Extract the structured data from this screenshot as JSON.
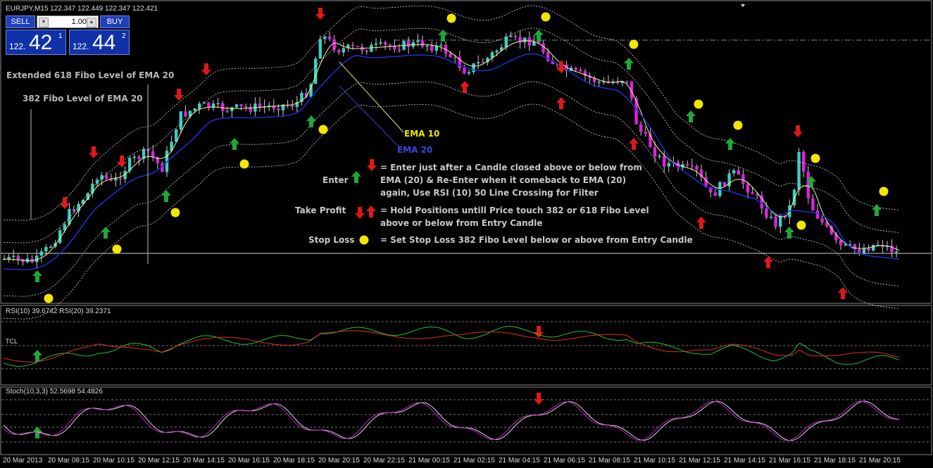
{
  "window": {
    "symbol_header": "EURJPY,M15  122.347 122.449 122.347 122.421"
  },
  "trade_panel": {
    "sell_label": "SELL",
    "buy_label": "BUY",
    "lot_value": "1.00",
    "bid_prefix": "122.",
    "bid_big": "42",
    "bid_sup": "1",
    "ask_prefix": "122.",
    "ask_big": "44",
    "ask_sup": "2"
  },
  "annotations": {
    "fibo618": "Extended 618 Fibo Level of EMA 20",
    "fibo382": "382 Fibo Level of EMA 20",
    "ema10": "EMA 10",
    "ema20": "EMA 20"
  },
  "legend": {
    "enter_label": "Enter",
    "enter_text": [
      "= Enter just after a Candle closed above or below from",
      "EMA (20) & Re-Enter when it comeback to EMA (20)",
      "again, Use RSI (10) 50 Line Crossing for Filter"
    ],
    "tp_label": "Take Profit",
    "tp_text": [
      "= Hold Positions untill Price touch 382 or 618 Fibo Level",
      "above or below from Entry Candle"
    ],
    "sl_label": "Stop Loss",
    "sl_text": "= Set Stop Loss 382 Fibo Level below or above from Entry Candle"
  },
  "rsi_panel": {
    "header": "RSI(10) 39.6742  RSI(20) 39.2371",
    "tcl_label": "TCL"
  },
  "stoch_panel": {
    "header": "Stoch(10,3,3) 52.5698 54.4826"
  },
  "time_axis": [
    "20 Mar 2013",
    "20 Mar 08:15",
    "20 Mar 10:15",
    "20 Mar 12:15",
    "20 Mar 14:15",
    "20 Mar 16:15",
    "20 Mar 18:15",
    "20 Mar 20:15",
    "20 Mar 22:15",
    "21 Mar 00:15",
    "21 Mar 02:15",
    "21 Mar 04:15",
    "21 Mar 06:15",
    "21 Mar 08:15",
    "21 Mar 10:15",
    "21 Mar 12:15",
    "21 Mar 14:15",
    "21 Mar 16:15",
    "21 Mar 18:15",
    "21 Mar 20:15"
  ],
  "colors": {
    "bull_candle": "#3ad0c0",
    "bear_candle": "#e020e0",
    "ema10": "#f4f4a0",
    "ema20": "#2030d0",
    "buy_arrow": "#1fa83a",
    "sell_arrow": "#e01818",
    "stop_dot": "#f2e600",
    "rsi10": "#22c22e",
    "rsi20": "#e03020"
  }
}
